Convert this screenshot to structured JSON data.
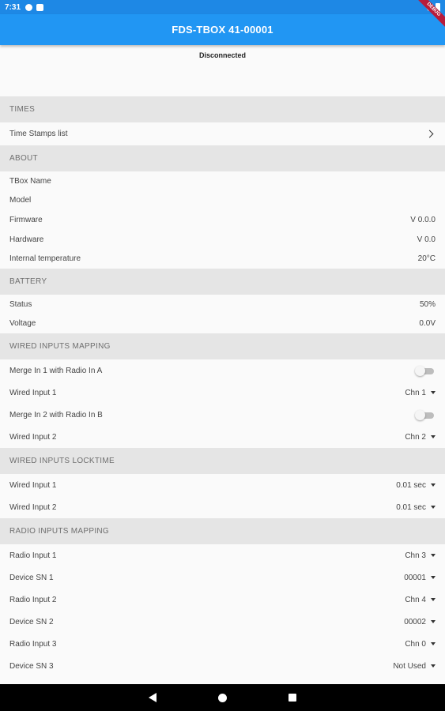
{
  "status_bar": {
    "time": "7:31",
    "debug_label": "DEBUG"
  },
  "app_bar": {
    "title": "FDS-TBOX 41-00001"
  },
  "connection": {
    "status": "Disconnected"
  },
  "sections": {
    "times": {
      "header": "TIMES",
      "time_stamps": "Time Stamps list"
    },
    "about": {
      "header": "ABOUT",
      "rows": [
        {
          "label": "TBox Name",
          "value": ""
        },
        {
          "label": "Model",
          "value": ""
        },
        {
          "label": "Firmware",
          "value": "V 0.0.0"
        },
        {
          "label": "Hardware",
          "value": "V 0.0"
        },
        {
          "label": "Internal temperature",
          "value": "20°C"
        }
      ]
    },
    "battery": {
      "header": "BATTERY",
      "rows": [
        {
          "label": "Status",
          "value": "50%"
        },
        {
          "label": "Voltage",
          "value": "0.0V"
        }
      ]
    },
    "wired_mapping": {
      "header": "WIRED INPUTS MAPPING",
      "merge1": {
        "label": "Merge In 1 with Radio In A",
        "enabled": false
      },
      "input1": {
        "label": "Wired Input 1",
        "value": "Chn 1"
      },
      "merge2": {
        "label": "Merge In 2 with Radio In B",
        "enabled": false
      },
      "input2": {
        "label": "Wired Input 2",
        "value": "Chn 2"
      }
    },
    "wired_locktime": {
      "header": "WIRED INPUTS LOCKTIME",
      "rows": [
        {
          "label": "Wired Input 1",
          "value": "0.01 sec"
        },
        {
          "label": "Wired Input 2",
          "value": "0.01 sec"
        }
      ]
    },
    "radio_mapping": {
      "header": "RADIO INPUTS MAPPING",
      "rows": [
        {
          "label": "Radio Input 1",
          "value": "Chn 3"
        },
        {
          "label": "Device SN 1",
          "value": "00001"
        },
        {
          "label": "Radio Input 2",
          "value": "Chn 4"
        },
        {
          "label": "Device SN 2",
          "value": "00002"
        },
        {
          "label": "Radio Input 3",
          "value": "Chn 0"
        },
        {
          "label": "Device SN 3",
          "value": "Not Used"
        }
      ]
    }
  },
  "colors": {
    "app_bar": "#2196f3",
    "status_bar": "#1e88e5",
    "section_bg": "#e5e5e5",
    "nav_bar": "#000000"
  }
}
